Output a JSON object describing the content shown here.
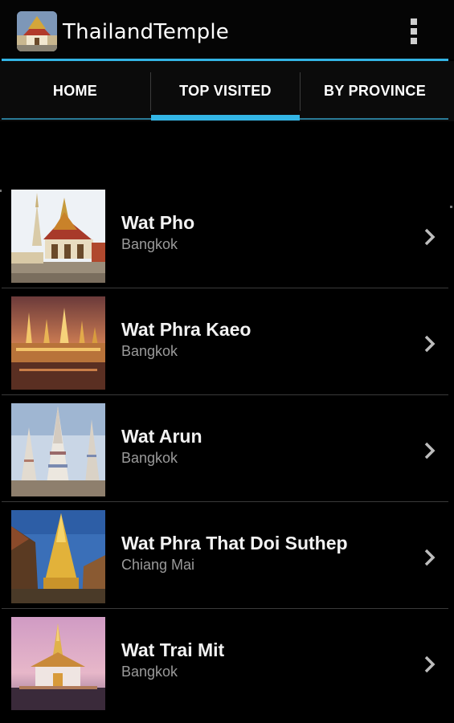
{
  "app": {
    "title": "ThailandTemple",
    "icon": "temple-app-icon",
    "overflow_icon": "overflow-menu-icon"
  },
  "tabs": [
    {
      "label": "HOME",
      "selected": false
    },
    {
      "label": "TOP VISITED",
      "selected": true
    },
    {
      "label": "BY PROVINCE",
      "selected": false
    }
  ],
  "colors": {
    "accent": "#33b5e5",
    "background": "#000000",
    "title_text": "#f2f2f2",
    "subtitle_text": "#9a9a9a"
  },
  "temples": [
    {
      "name": "Wat Pho",
      "province": "Bangkok",
      "icon": "chevron-right-icon"
    },
    {
      "name": "Wat Phra Kaeo",
      "province": "Bangkok",
      "icon": "chevron-right-icon"
    },
    {
      "name": "Wat Arun",
      "province": "Bangkok",
      "icon": "chevron-right-icon"
    },
    {
      "name": "Wat Phra That Doi Suthep",
      "province": "Chiang Mai",
      "icon": "chevron-right-icon"
    },
    {
      "name": "Wat Trai Mit",
      "province": "Bangkok",
      "icon": "chevron-right-icon"
    }
  ]
}
